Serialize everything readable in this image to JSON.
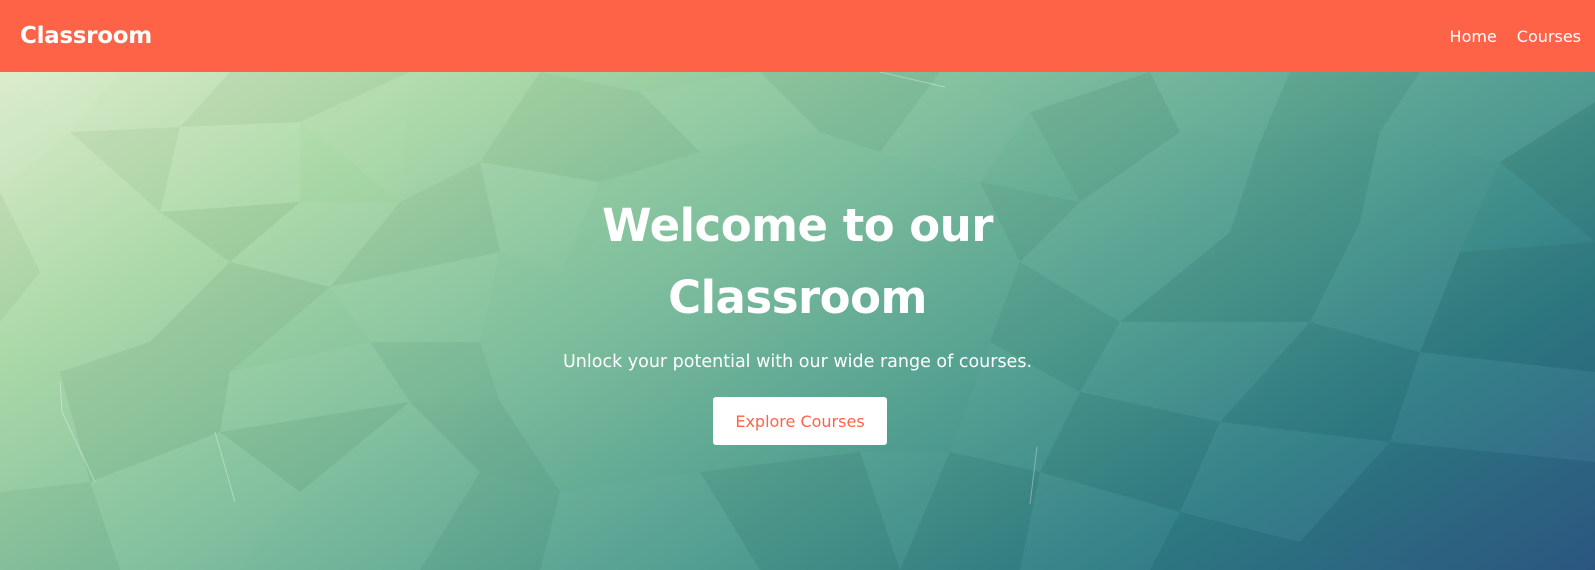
{
  "navbar": {
    "brand": "Classroom",
    "links": [
      {
        "label": "Home"
      },
      {
        "label": "Courses"
      }
    ],
    "background_color": "#ff6347"
  },
  "hero": {
    "title_line1": "Welcome to our",
    "title_line2": "Classroom",
    "subtitle": "Unlock your potential with our wide range of courses.",
    "cta_label": "Explore Courses",
    "cta_text_color": "#ff6347",
    "background_colors": [
      "#d9ebc7",
      "#a9d8a6",
      "#7fbf9c",
      "#4f9d8f",
      "#2f7d86",
      "#2d5a86"
    ]
  }
}
